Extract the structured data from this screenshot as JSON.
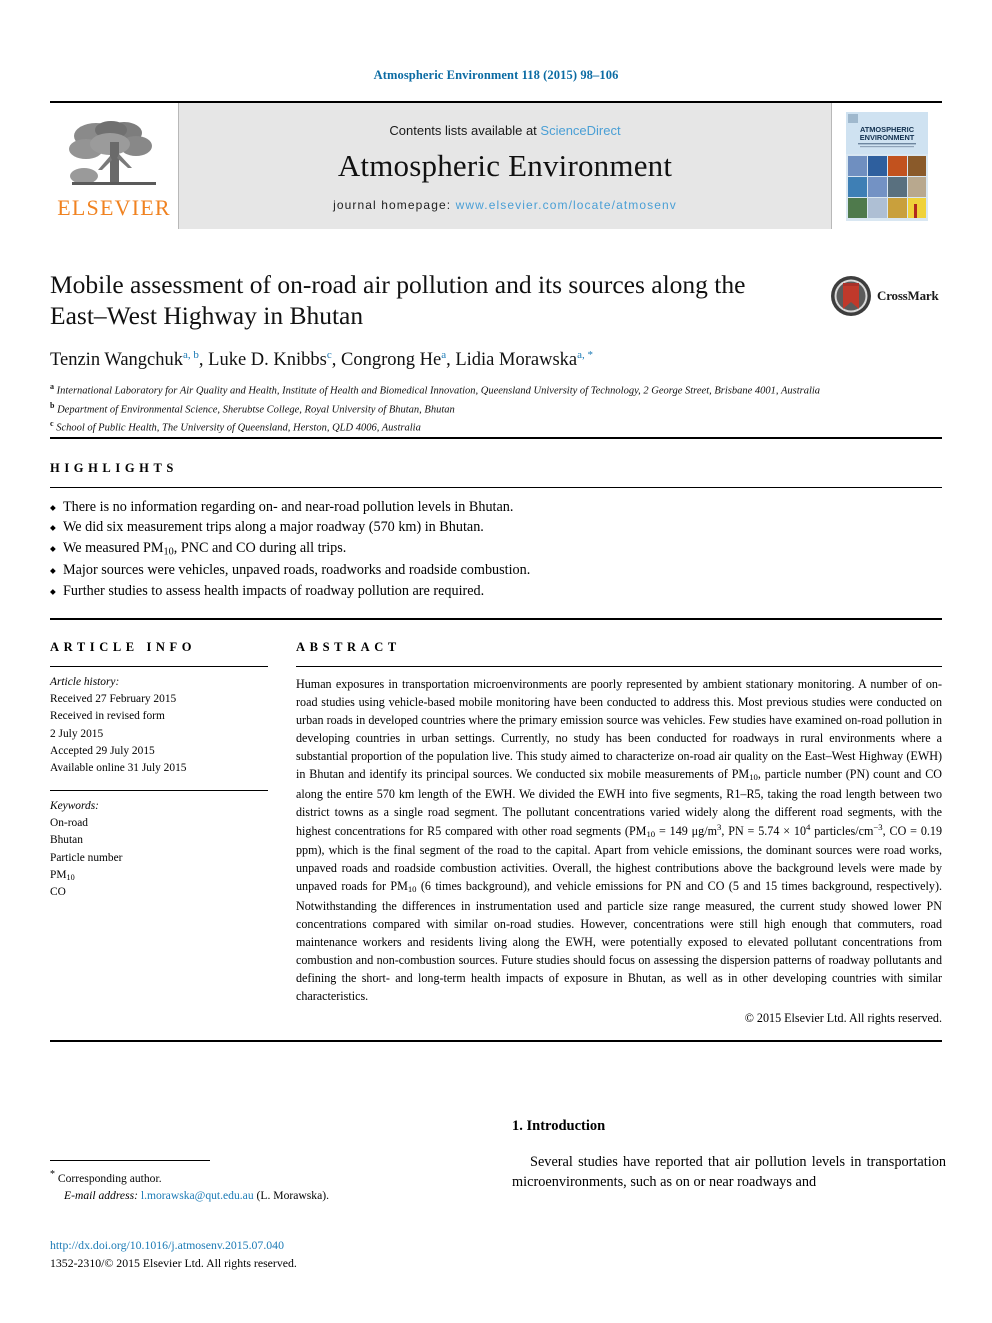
{
  "running_head": "Atmospheric Environment 118 (2015) 98–106",
  "masthead": {
    "contents_prefix": "Contents lists available at ",
    "contents_link": "ScienceDirect",
    "journal_name": "Atmospheric Environment",
    "homepage_prefix": "journal homepage: ",
    "homepage_link": "www.elsevier.com/locate/atmosenv",
    "publisher_wordmark": "ELSEVIER",
    "cover_title_line1": "ATMOSPHERIC",
    "cover_title_line2": "ENVIRONMENT"
  },
  "article": {
    "title": "Mobile assessment of on-road air pollution and its sources along the East–West Highway in Bhutan",
    "crossmark_label": "CrossMark",
    "authors": [
      {
        "name": "Tenzin Wangchuk",
        "marks": "a, b",
        "sep": ", "
      },
      {
        "name": "Luke D. Knibbs",
        "marks": "c",
        "sep": ", "
      },
      {
        "name": "Congrong He",
        "marks": "a",
        "sep": ", "
      },
      {
        "name": "Lidia Morawska",
        "marks": "a, *",
        "sep": ""
      }
    ],
    "affiliations": [
      {
        "mark": "a",
        "text": "International Laboratory for Air Quality and Health, Institute of Health and Biomedical Innovation, Queensland University of Technology, 2 George Street, Brisbane 4001, Australia"
      },
      {
        "mark": "b",
        "text": "Department of Environmental Science, Sherubtse College, Royal University of Bhutan, Bhutan"
      },
      {
        "mark": "c",
        "text": "School of Public Health, The University of Queensland, Herston, QLD 4006, Australia"
      }
    ]
  },
  "highlights": {
    "heading": "HIGHLIGHTS",
    "items": [
      "There is no information regarding on- and near-road pollution levels in Bhutan.",
      "We did six measurement trips along a major roadway (570 km) in Bhutan.",
      "We measured PM10, PNC and CO during all trips.",
      "Major sources were vehicles, unpaved roads, roadworks and roadside combustion.",
      "Further studies to assess health impacts of roadway pollution are required."
    ]
  },
  "article_info": {
    "heading": "ARTICLE INFO",
    "history_label": "Article history:",
    "history": [
      "Received 27 February 2015",
      "Received in revised form",
      "2 July 2015",
      "Accepted 29 July 2015",
      "Available online 31 July 2015"
    ],
    "keywords_label": "Keywords:",
    "keywords": [
      "On-road",
      "Bhutan",
      "Particle number",
      "PM10",
      "CO"
    ]
  },
  "abstract": {
    "heading": "ABSTRACT",
    "text": "Human exposures in transportation microenvironments are poorly represented by ambient stationary monitoring. A number of on-road studies using vehicle-based mobile monitoring have been conducted to address this. Most previous studies were conducted on urban roads in developed countries where the primary emission source was vehicles. Few studies have examined on-road pollution in developing countries in urban settings. Currently, no study has been conducted for roadways in rural environments where a substantial proportion of the population live. This study aimed to characterize on-road air quality on the East–West Highway (EWH) in Bhutan and identify its principal sources. We conducted six mobile measurements of PM10, particle number (PN) count and CO along the entire 570 km length of the EWH. We divided the EWH into five segments, R1–R5, taking the road length between two district towns as a single road segment. The pollutant concentrations varied widely along the different road segments, with the highest concentrations for R5 compared with other road segments (PM10 = 149 μg/m3, PN = 5.74 × 104 particles/cm−3, CO = 0.19 ppm), which is the final segment of the road to the capital. Apart from vehicle emissions, the dominant sources were road works, unpaved roads and roadside combustion activities. Overall, the highest contributions above the background levels were made by unpaved roads for PM10 (6 times background), and vehicle emissions for PN and CO (5 and 15 times background, respectively). Notwithstanding the differences in instrumentation used and particle size range measured, the current study showed lower PN concentrations compared with similar on-road studies. However, concentrations were still high enough that commuters, road maintenance workers and residents living along the EWH, were potentially exposed to elevated pollutant concentrations from combustion and non-combustion sources. Future studies should focus on assessing the dispersion patterns of roadway pollutants and defining the short- and long-term health impacts of exposure in Bhutan, as well as in other developing countries with similar characteristics.",
    "copyright": "© 2015 Elsevier Ltd. All rights reserved."
  },
  "introduction": {
    "heading": "1. Introduction",
    "paragraph": "Several studies have reported that air pollution levels in transportation microenvironments, such as on or near roadways and"
  },
  "footnotes": {
    "corresponding_author": "Corresponding author.",
    "email_label": "E-mail address:",
    "email": "l.morawska@qut.edu.au",
    "email_owner": "(L. Morawska).",
    "doi_url": "http://dx.doi.org/10.1016/j.atmosenv.2015.07.040",
    "issn_line": "1352-2310/© 2015 Elsevier Ltd. All rights reserved."
  },
  "colors": {
    "link_blue": "#1b7ab5",
    "sciencedirect_blue": "#4a9fd5",
    "running_head_blue": "#0b6ba3",
    "elsevier_orange": "#f08220",
    "masthead_gray": "#e6e6e6"
  }
}
